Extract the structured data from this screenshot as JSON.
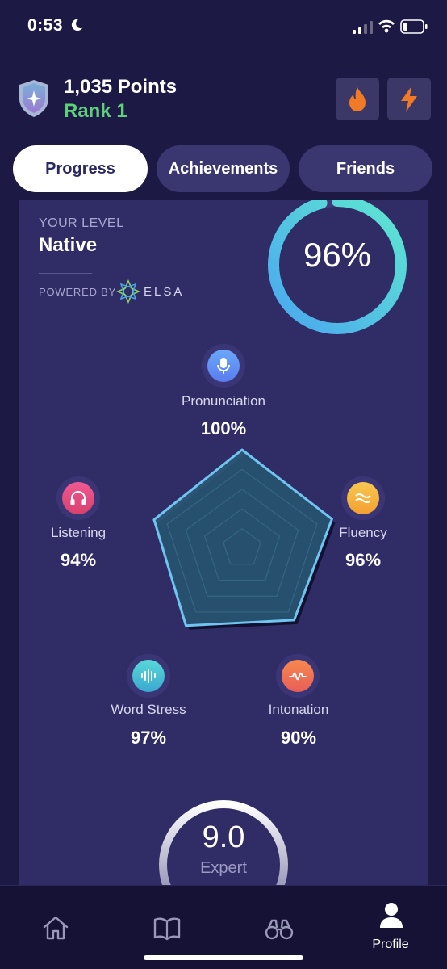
{
  "status_bar": {
    "time": "0:53",
    "icons": [
      "moon-icon",
      "signal-icon",
      "wifi-icon",
      "battery-icon"
    ]
  },
  "header": {
    "points": "1,035 Points",
    "rank": "Rank 1",
    "badge_icon": "shield-badge-icon",
    "buttons": [
      {
        "icon": "fire-icon"
      },
      {
        "icon": "lightning-icon"
      }
    ]
  },
  "tabs": [
    {
      "label": "Progress",
      "active": true
    },
    {
      "label": "Achievements",
      "active": false
    },
    {
      "label": "Friends",
      "active": false
    }
  ],
  "level": {
    "caption": "YOUR LEVEL",
    "value": "Native",
    "powered_by": "POWERED BY",
    "brand": "ELSA",
    "overall_percent": "96%",
    "overall_fraction": 0.96
  },
  "skills": [
    {
      "name": "Pronunciation",
      "value": "100%",
      "score": 1.0,
      "icon": "microphone-icon",
      "color": "#6a9cf4"
    },
    {
      "name": "Fluency",
      "value": "96%",
      "score": 0.96,
      "icon": "waves-icon",
      "color": "#f4b63c"
    },
    {
      "name": "Intonation",
      "value": "90%",
      "score": 0.9,
      "icon": "intonation-wave-icon",
      "color": "#f17a4a"
    },
    {
      "name": "Word Stress",
      "value": "97%",
      "score": 0.97,
      "icon": "sound-bars-icon",
      "color": "#48c8d8"
    },
    {
      "name": "Listening",
      "value": "94%",
      "score": 0.94,
      "icon": "headphones-icon",
      "color": "#e8507e"
    }
  ],
  "score": {
    "value": "9.0",
    "label": "Expert"
  },
  "colors": {
    "background": "#1c1a44",
    "card": "#302c66",
    "rank_green": "#5ed07a",
    "ring_start": "#4aa6f0",
    "ring_end": "#5ee8d0"
  },
  "bottom_nav": [
    {
      "icon": "home-icon",
      "label": ""
    },
    {
      "icon": "book-icon",
      "label": ""
    },
    {
      "icon": "binoculars-icon",
      "label": ""
    },
    {
      "icon": "profile-icon",
      "label": "Profile",
      "active": true
    }
  ]
}
